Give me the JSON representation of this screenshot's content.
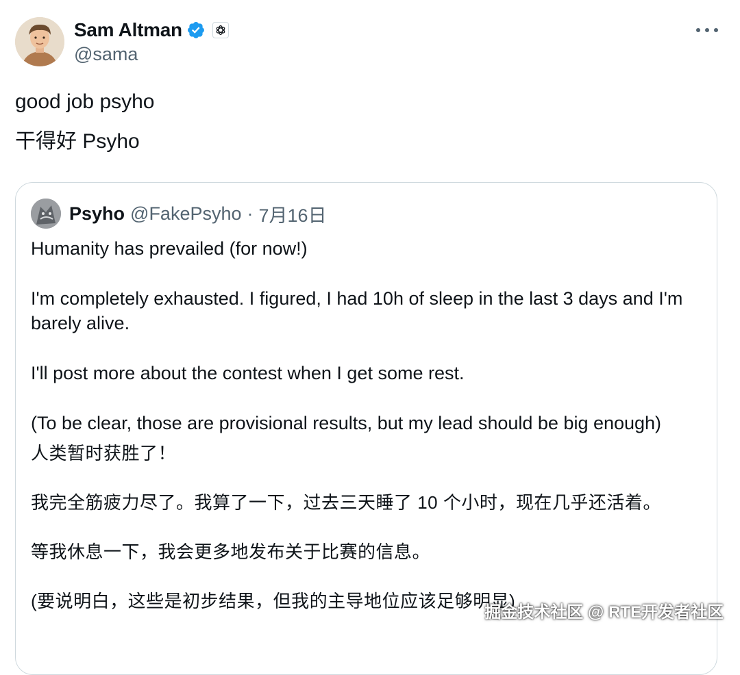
{
  "author": {
    "display_name": "Sam Altman",
    "handle": "@sama",
    "verified_icon": "verified-badge-icon",
    "affiliation_icon": "openai-logo-icon",
    "badge_color": "#1d9bf0"
  },
  "more_icon": "more-options-icon",
  "tweet": {
    "lines": [
      "good job psyho",
      "干得好 Psyho"
    ]
  },
  "quoted": {
    "display_name": "Psyho",
    "handle": "@FakePsyho",
    "separator": "·",
    "date": "7月16日",
    "paragraphs": [
      "Humanity has prevailed (for now!)",
      "I'm completely exhausted. I figured, I had 10h of sleep in the last 3 days and I'm barely alive.",
      "I'll post more about the contest when I get some rest.",
      "(To be clear, those are provisional results, but my lead should be big enough)",
      "人类暂时获胜了！",
      "我完全筋疲力尽了。我算了一下，过去三天睡了 10 个小时，现在几乎还活着。",
      "等我休息一下，我会更多地发布关于比赛的信息。",
      "(要说明白，这些是初步结果，但我的主导地位应该足够明显)"
    ]
  },
  "watermark": "掘金技术社区 @ RTE开发者社区",
  "colors": {
    "text": "#0f1419",
    "secondary": "#536471",
    "border": "#cfd9de"
  }
}
